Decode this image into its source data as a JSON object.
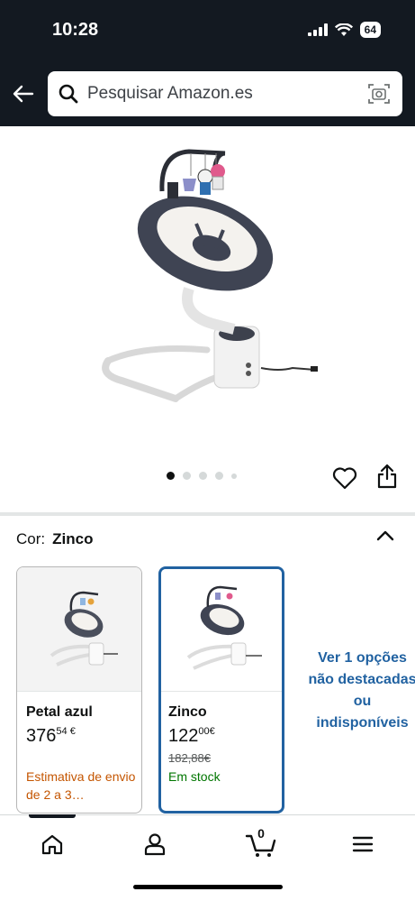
{
  "status_bar": {
    "time": "10:28",
    "battery": "64"
  },
  "search": {
    "placeholder": "Pesquisar Amazon.es"
  },
  "carousel": {
    "total": 5,
    "active": 0
  },
  "color_selector": {
    "label": "Cor:",
    "value": "Zinco"
  },
  "variants": [
    {
      "name": "Petal azul",
      "price_whole": "376",
      "price_fraction": "54",
      "currency": "€",
      "shipping": "Estimativa de envio de 2 a 3…"
    },
    {
      "name": "Zinco",
      "price_whole": "122",
      "price_fraction": "00",
      "currency": "€",
      "old_price": "182,88€",
      "stock": "Em stock"
    }
  ],
  "more_options": "Ver 1 opções não destacadas ou indisponíveis",
  "bottom_nav": {
    "cart_count": "0",
    "items": [
      "home-icon",
      "account-icon",
      "cart-icon",
      "menu-icon"
    ]
  },
  "colors": {
    "header": "#131921",
    "link": "#2162a1",
    "stock": "#007600",
    "shipping": "#c45500"
  }
}
